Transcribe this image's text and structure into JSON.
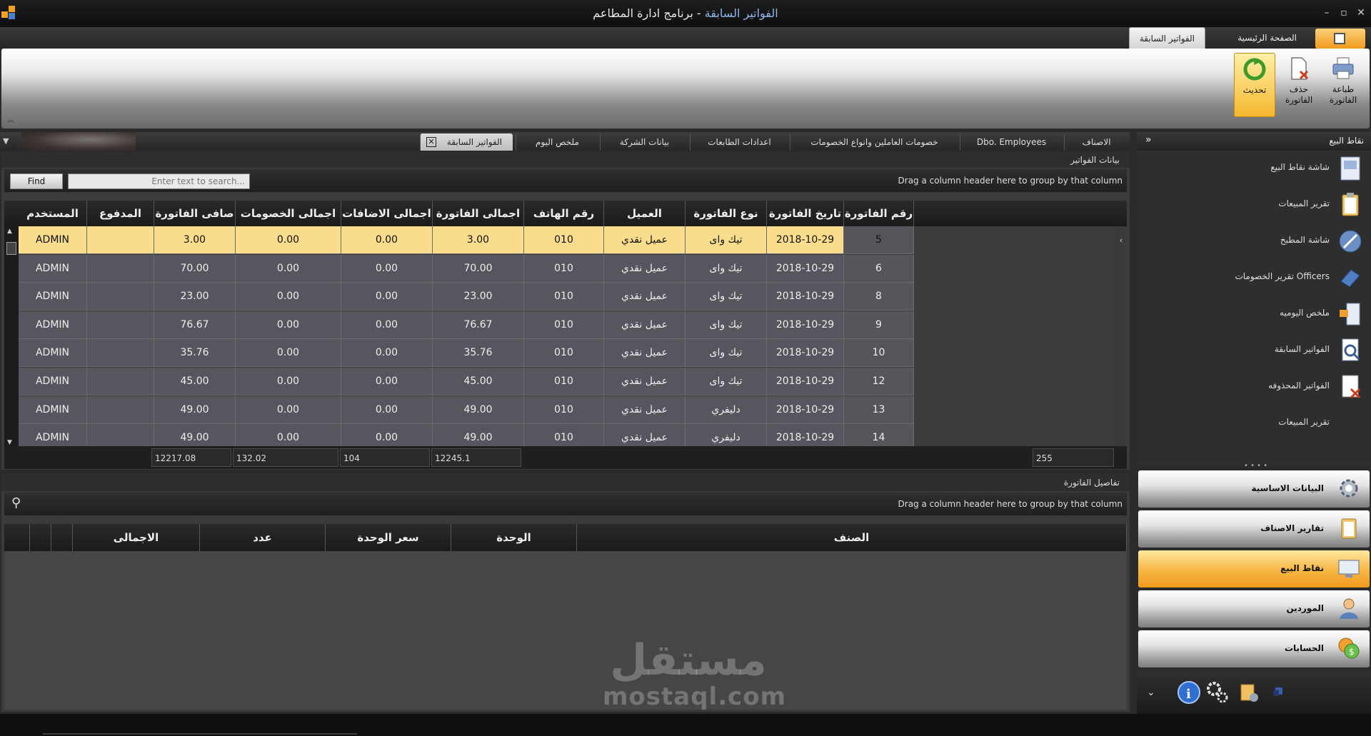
{
  "window": {
    "title_part1": "الفواتير السابقة",
    "title_sep": " - ",
    "title_part2": "برنامج ادارة المطاعم"
  },
  "ribbon": {
    "tabs": [
      "الفواتير السابقة",
      "الصفحة الرئيسية"
    ],
    "buttons": {
      "refresh": "تحديث",
      "delete_invoice": "حذف الفاتورة",
      "print_invoice_line1": "طباعة",
      "print_invoice_line2": "الفاتورة"
    }
  },
  "doc_tabs": [
    "الفواتير السابقة",
    "ملخص اليوم",
    "بيانات الشركة",
    "اعدادات الطابعات",
    "خصومات العاملين وانواع الخصومات",
    "Dbo. Employees",
    "الاصناف"
  ],
  "invoices": {
    "panel_title": "بيانات الفواتير",
    "find_label": "Find",
    "search_placeholder": "Enter text to search...",
    "group_hint": "Drag a column header here to group by that column",
    "columns": [
      "رقم الفاتورة",
      "تاريخ الفاتورة",
      "نوع الفاتورة",
      "العميل",
      "رقم الهاتف",
      "اجمالى الفاتورة",
      "اجمالى الاضافات",
      "اجمالى الخصومات",
      "صافى الفاتورة",
      "المدفوع",
      "المستخدم"
    ],
    "rows": [
      [
        "5",
        "2018-10-29",
        "تيك واى",
        "عميل نقدي",
        "010",
        "3.00",
        "0.00",
        "0.00",
        "3.00",
        "",
        "ADMIN"
      ],
      [
        "6",
        "2018-10-29",
        "تيك واى",
        "عميل نقدي",
        "010",
        "70.00",
        "0.00",
        "0.00",
        "70.00",
        "",
        "ADMIN"
      ],
      [
        "8",
        "2018-10-29",
        "تيك واى",
        "عميل نقدي",
        "010",
        "23.00",
        "0.00",
        "0.00",
        "23.00",
        "",
        "ADMIN"
      ],
      [
        "9",
        "2018-10-29",
        "تيك واى",
        "عميل نقدي",
        "010",
        "76.67",
        "0.00",
        "0.00",
        "76.67",
        "",
        "ADMIN"
      ],
      [
        "10",
        "2018-10-29",
        "تيك واى",
        "عميل نقدي",
        "010",
        "35.76",
        "0.00",
        "0.00",
        "35.76",
        "",
        "ADMIN"
      ],
      [
        "12",
        "2018-10-29",
        "تيك واى",
        "عميل نقدي",
        "010",
        "45.00",
        "0.00",
        "0.00",
        "45.00",
        "",
        "ADMIN"
      ],
      [
        "13",
        "2018-10-29",
        "دليفري",
        "عميل نقدي",
        "010",
        "49.00",
        "0.00",
        "0.00",
        "49.00",
        "",
        "ADMIN"
      ],
      [
        "14",
        "2018-10-29",
        "دليفري",
        "عميل نقدي",
        "010",
        "49.00",
        "0.00",
        "0.00",
        "49.00",
        "",
        "ADMIN"
      ]
    ],
    "selected_row": 0,
    "footer": {
      "count": "255",
      "total_invoice": "12245.1",
      "total_additions": "104",
      "total_discounts": "132.02",
      "net_total": "12217.08"
    }
  },
  "details": {
    "panel_title": "تفاصيل الفاتورة",
    "group_hint": "Drag a column header here to group by that column",
    "columns": [
      "الصنف",
      "الوحدة",
      "سعر الوحدة",
      "عدد",
      "الاجمالى"
    ]
  },
  "nav": {
    "title": "نقاط البيع",
    "items": [
      "شاشة نقاط البيع",
      "تقرير المبيعات",
      "شاشة المطبخ",
      "تقرير الخصومات Officers",
      "ملخص اليوميه",
      "الفواتير السابقة",
      "الفواتير المحذوفه",
      "تقرير المبيعات"
    ],
    "groups": [
      "البيانات الاساسية",
      "تقارير الاصناف",
      "نقاط البيع",
      "الموردين",
      "الحسابات"
    ],
    "active_group": "نقاط البيع"
  },
  "watermark": {
    "arabic": "مستقل",
    "latin": "mostaql.com"
  },
  "colors": {
    "selected_row": "#f9dd8c",
    "accent_orange": "#f5b82e",
    "row_bg": "#57555d"
  }
}
